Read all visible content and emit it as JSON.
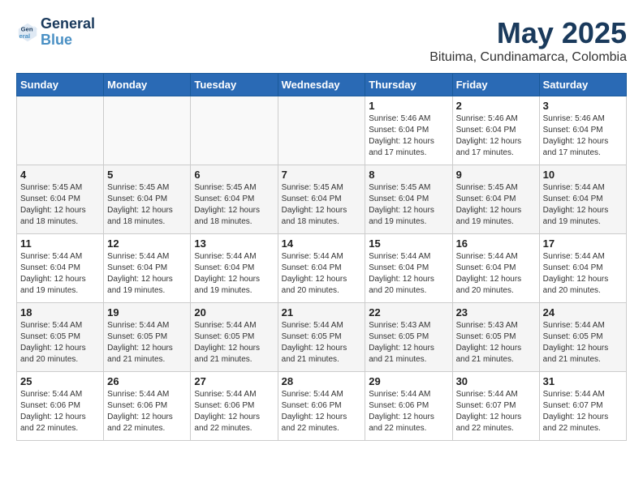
{
  "header": {
    "logo_line1": "General",
    "logo_line2": "Blue",
    "month_year": "May 2025",
    "location": "Bituima, Cundinamarca, Colombia"
  },
  "days_of_week": [
    "Sunday",
    "Monday",
    "Tuesday",
    "Wednesday",
    "Thursday",
    "Friday",
    "Saturday"
  ],
  "weeks": [
    [
      {
        "day": "",
        "info": ""
      },
      {
        "day": "",
        "info": ""
      },
      {
        "day": "",
        "info": ""
      },
      {
        "day": "",
        "info": ""
      },
      {
        "day": "1",
        "info": "Sunrise: 5:46 AM\nSunset: 6:04 PM\nDaylight: 12 hours\nand 17 minutes."
      },
      {
        "day": "2",
        "info": "Sunrise: 5:46 AM\nSunset: 6:04 PM\nDaylight: 12 hours\nand 17 minutes."
      },
      {
        "day": "3",
        "info": "Sunrise: 5:46 AM\nSunset: 6:04 PM\nDaylight: 12 hours\nand 17 minutes."
      }
    ],
    [
      {
        "day": "4",
        "info": "Sunrise: 5:45 AM\nSunset: 6:04 PM\nDaylight: 12 hours\nand 18 minutes."
      },
      {
        "day": "5",
        "info": "Sunrise: 5:45 AM\nSunset: 6:04 PM\nDaylight: 12 hours\nand 18 minutes."
      },
      {
        "day": "6",
        "info": "Sunrise: 5:45 AM\nSunset: 6:04 PM\nDaylight: 12 hours\nand 18 minutes."
      },
      {
        "day": "7",
        "info": "Sunrise: 5:45 AM\nSunset: 6:04 PM\nDaylight: 12 hours\nand 18 minutes."
      },
      {
        "day": "8",
        "info": "Sunrise: 5:45 AM\nSunset: 6:04 PM\nDaylight: 12 hours\nand 19 minutes."
      },
      {
        "day": "9",
        "info": "Sunrise: 5:45 AM\nSunset: 6:04 PM\nDaylight: 12 hours\nand 19 minutes."
      },
      {
        "day": "10",
        "info": "Sunrise: 5:44 AM\nSunset: 6:04 PM\nDaylight: 12 hours\nand 19 minutes."
      }
    ],
    [
      {
        "day": "11",
        "info": "Sunrise: 5:44 AM\nSunset: 6:04 PM\nDaylight: 12 hours\nand 19 minutes."
      },
      {
        "day": "12",
        "info": "Sunrise: 5:44 AM\nSunset: 6:04 PM\nDaylight: 12 hours\nand 19 minutes."
      },
      {
        "day": "13",
        "info": "Sunrise: 5:44 AM\nSunset: 6:04 PM\nDaylight: 12 hours\nand 19 minutes."
      },
      {
        "day": "14",
        "info": "Sunrise: 5:44 AM\nSunset: 6:04 PM\nDaylight: 12 hours\nand 20 minutes."
      },
      {
        "day": "15",
        "info": "Sunrise: 5:44 AM\nSunset: 6:04 PM\nDaylight: 12 hours\nand 20 minutes."
      },
      {
        "day": "16",
        "info": "Sunrise: 5:44 AM\nSunset: 6:04 PM\nDaylight: 12 hours\nand 20 minutes."
      },
      {
        "day": "17",
        "info": "Sunrise: 5:44 AM\nSunset: 6:04 PM\nDaylight: 12 hours\nand 20 minutes."
      }
    ],
    [
      {
        "day": "18",
        "info": "Sunrise: 5:44 AM\nSunset: 6:05 PM\nDaylight: 12 hours\nand 20 minutes."
      },
      {
        "day": "19",
        "info": "Sunrise: 5:44 AM\nSunset: 6:05 PM\nDaylight: 12 hours\nand 21 minutes."
      },
      {
        "day": "20",
        "info": "Sunrise: 5:44 AM\nSunset: 6:05 PM\nDaylight: 12 hours\nand 21 minutes."
      },
      {
        "day": "21",
        "info": "Sunrise: 5:44 AM\nSunset: 6:05 PM\nDaylight: 12 hours\nand 21 minutes."
      },
      {
        "day": "22",
        "info": "Sunrise: 5:43 AM\nSunset: 6:05 PM\nDaylight: 12 hours\nand 21 minutes."
      },
      {
        "day": "23",
        "info": "Sunrise: 5:43 AM\nSunset: 6:05 PM\nDaylight: 12 hours\nand 21 minutes."
      },
      {
        "day": "24",
        "info": "Sunrise: 5:44 AM\nSunset: 6:05 PM\nDaylight: 12 hours\nand 21 minutes."
      }
    ],
    [
      {
        "day": "25",
        "info": "Sunrise: 5:44 AM\nSunset: 6:06 PM\nDaylight: 12 hours\nand 22 minutes."
      },
      {
        "day": "26",
        "info": "Sunrise: 5:44 AM\nSunset: 6:06 PM\nDaylight: 12 hours\nand 22 minutes."
      },
      {
        "day": "27",
        "info": "Sunrise: 5:44 AM\nSunset: 6:06 PM\nDaylight: 12 hours\nand 22 minutes."
      },
      {
        "day": "28",
        "info": "Sunrise: 5:44 AM\nSunset: 6:06 PM\nDaylight: 12 hours\nand 22 minutes."
      },
      {
        "day": "29",
        "info": "Sunrise: 5:44 AM\nSunset: 6:06 PM\nDaylight: 12 hours\nand 22 minutes."
      },
      {
        "day": "30",
        "info": "Sunrise: 5:44 AM\nSunset: 6:07 PM\nDaylight: 12 hours\nand 22 minutes."
      },
      {
        "day": "31",
        "info": "Sunrise: 5:44 AM\nSunset: 6:07 PM\nDaylight: 12 hours\nand 22 minutes."
      }
    ]
  ]
}
